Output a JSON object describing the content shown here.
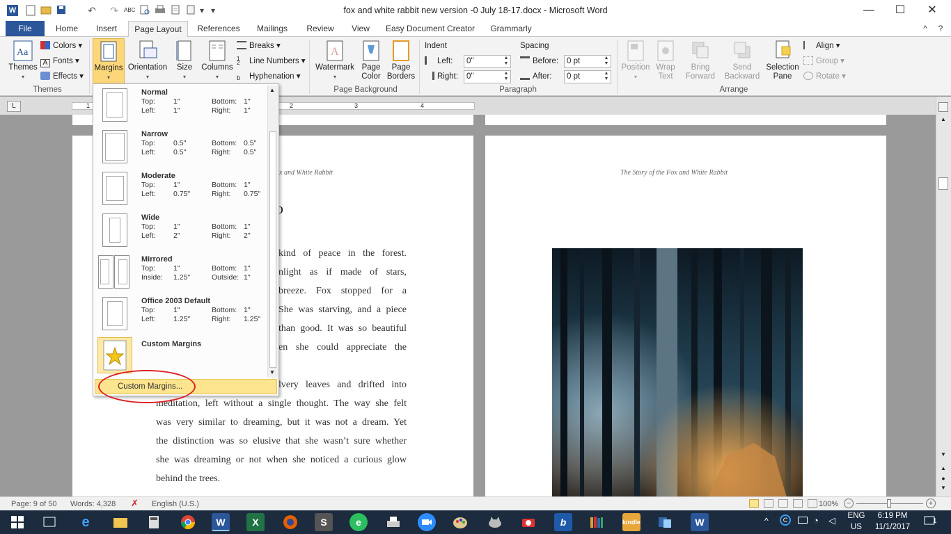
{
  "window": {
    "title": "fox and white rabbit new version -0 July 18-17.docx  -  Microsoft Word",
    "minimize": "—",
    "maximize": "☐",
    "close": "✕",
    "help": "?",
    "collapse": "^"
  },
  "qat": {
    "undo": "↶",
    "redo": "↷",
    "dropdown": "▾"
  },
  "tabs": [
    "File",
    "Home",
    "Insert",
    "Page Layout",
    "References",
    "Mailings",
    "Review",
    "View",
    "Easy Document Creator",
    "Grammarly"
  ],
  "active_tab": "Page Layout",
  "ribbon": {
    "themes": {
      "themes_label": "Themes",
      "colors": "Colors",
      "fonts": "Fonts",
      "effects": "Effects",
      "group": "Themes"
    },
    "page_setup": {
      "margins": "Margins",
      "orientation": "Orientation",
      "size": "Size",
      "columns": "Columns",
      "breaks": "Breaks",
      "line_numbers": "Line Numbers",
      "hyphenation": "Hyphenation"
    },
    "page_background": {
      "watermark": "Watermark",
      "page_color_1": "Page",
      "page_color_2": "Color",
      "page_borders_1": "Page",
      "page_borders_2": "Borders",
      "group": "Page Background"
    },
    "paragraph": {
      "indent_title": "Indent",
      "left_label": "Left:",
      "left_value": "0\"",
      "right_label": "Right:",
      "right_value": "0\"",
      "spacing_title": "Spacing",
      "before_label": "Before:",
      "before_value": "0 pt",
      "after_label": "After:",
      "after_value": "0 pt",
      "group": "Paragraph"
    },
    "arrange": {
      "position": "Position",
      "wrap_1": "Wrap",
      "wrap_2": "Text",
      "bring_1": "Bring",
      "bring_2": "Forward",
      "send_1": "Send",
      "send_2": "Backward",
      "selection_1": "Selection",
      "selection_2": "Pane",
      "align": "Align",
      "group_btn": "Group",
      "rotate": "Rotate",
      "group": "Arrange"
    }
  },
  "ruler": {
    "marks": [
      "1",
      "2",
      "3",
      "4"
    ]
  },
  "margins_menu": {
    "presets": [
      {
        "name": "Normal",
        "k1": "Top:",
        "v1": "1\"",
        "k2": "Bottom:",
        "v2": "1\"",
        "k3": "Left:",
        "v3": "1\"",
        "k4": "Right:",
        "v4": "1\""
      },
      {
        "name": "Narrow",
        "k1": "Top:",
        "v1": "0.5\"",
        "k2": "Bottom:",
        "v2": "0.5\"",
        "k3": "Left:",
        "v3": "0.5\"",
        "k4": "Right:",
        "v4": "0.5\""
      },
      {
        "name": "Moderate",
        "k1": "Top:",
        "v1": "1\"",
        "k2": "Bottom:",
        "v2": "1\"",
        "k3": "Left:",
        "v3": "0.75\"",
        "k4": "Right:",
        "v4": "0.75\""
      },
      {
        "name": "Wide",
        "k1": "Top:",
        "v1": "1\"",
        "k2": "Bottom:",
        "v2": "1\"",
        "k3": "Left:",
        "v3": "2\"",
        "k4": "Right:",
        "v4": "2\""
      },
      {
        "name": "Mirrored",
        "k1": "Top:",
        "v1": "1\"",
        "k2": "Bottom:",
        "v2": "1\"",
        "k3": "Inside:",
        "v3": "1.25\"",
        "k4": "Outside:",
        "v4": "1\""
      },
      {
        "name": "Office 2003 Default",
        "k1": "Top:",
        "v1": "1\"",
        "k2": "Bottom:",
        "v2": "1\"",
        "k3": "Left:",
        "v3": "1.25\"",
        "k4": "Right:",
        "v4": "1.25\""
      }
    ],
    "custom_preset_name": "Custom Margins",
    "custom_command": "Custom Margins..."
  },
  "document": {
    "left_header": "Fox and White Rabbit",
    "right_header": "The Story of the Fox and White Rabbit",
    "heading_fragment": "o",
    "para1_fragments": [
      "kind of peace in the forest.",
      "nlight as if made of stars,",
      "breeze. Fox stopped for a",
      "She was starving, and a piece",
      "than good. It was so beautiful",
      "en she could appreciate the"
    ],
    "para2_lines": [
      "lvery leaves and drifted into",
      "meditation, left without a single thought. The way she felt",
      "was very similar to dreaming, but it was not a dream. Yet",
      "the distinction was so elusive that she wasn’t sure whether",
      "she was dreaming or not when she noticed a curious glow",
      "behind the trees."
    ]
  },
  "status": {
    "page": "Page: 9 of 50",
    "words": "Words: 4,328",
    "language": "English (U.S.)",
    "zoom": "100%"
  },
  "taskbar": {
    "lang_1": "ENG",
    "lang_2": "US",
    "time": "6:19 PM",
    "date": "11/1/2017",
    "notifications": "1"
  },
  "colors": {
    "word_blue": "#2b579a",
    "menu_highlight": "#fde58f",
    "annotation_red": "#d22222"
  }
}
